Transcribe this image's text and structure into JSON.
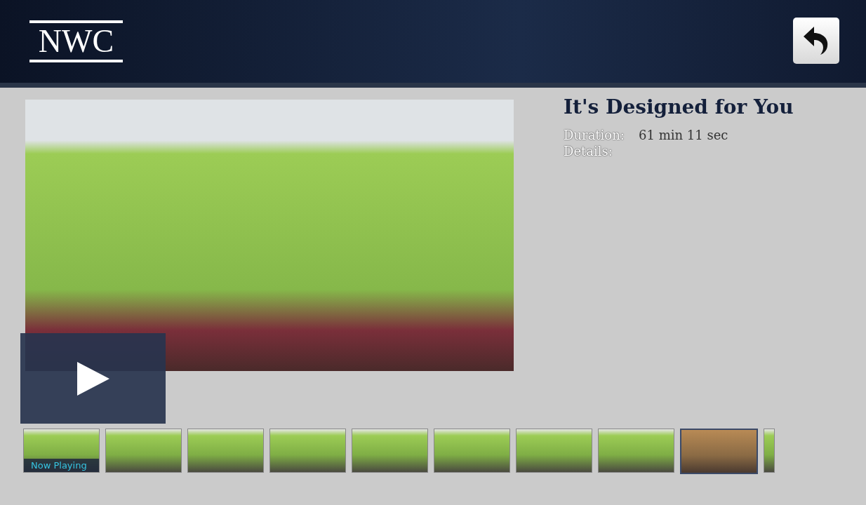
{
  "header": {
    "logo": "NWC"
  },
  "video": {
    "title": "It's Designed for You",
    "duration_label": "Duration:",
    "duration": "61 min 11 sec",
    "details_label": "Details:"
  },
  "thumbnails": [
    {
      "selected": false,
      "caption": "Now Playing"
    },
    {
      "selected": false
    },
    {
      "selected": false
    },
    {
      "selected": false
    },
    {
      "selected": false
    },
    {
      "selected": false
    },
    {
      "selected": false
    },
    {
      "selected": false
    },
    {
      "selected": true
    },
    {
      "selected": false
    }
  ]
}
